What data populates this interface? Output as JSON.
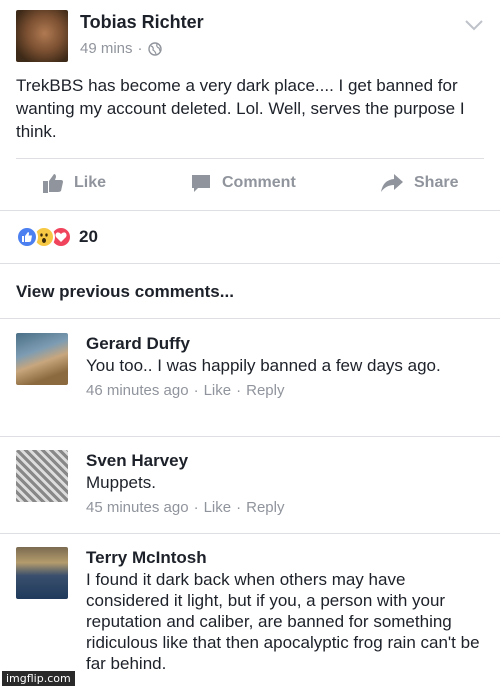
{
  "post": {
    "author": "Tobias Richter",
    "time": "49 mins",
    "meta_separator": "·",
    "text": "TrekBBS has become a very dark place.... I get banned for wanting my account deleted. Lol. Well, serves the purpose I think."
  },
  "actions": {
    "like": "Like",
    "comment": "Comment",
    "share": "Share"
  },
  "reactions": {
    "types": [
      "like",
      "wow",
      "love"
    ],
    "count": "20"
  },
  "view_previous": "View previous comments...",
  "comments": [
    {
      "name": "Gerard Duffy",
      "text": "You too.. I was happily banned a few days ago.",
      "time": "46 minutes ago",
      "like": "Like",
      "reply": "Reply"
    },
    {
      "name": "Sven Harvey",
      "text": "Muppets.",
      "time": "45 minutes ago",
      "like": "Like",
      "reply": "Reply"
    },
    {
      "name": "Terry McIntosh",
      "text": "I found it dark back when others may have considered it light, but if you, a person with your reputation and caliber, are banned for something ridiculous like that then apocalyptic frog rain can't be far behind.",
      "time": "",
      "like": "",
      "reply": ""
    }
  ],
  "watermark": "imgflip.com",
  "colors": {
    "text": "#1d2129",
    "secondary": "#90949c",
    "like_blue": "#4c80f0",
    "wow_yellow": "#f7c843",
    "love_red": "#f0435c",
    "divider": "#dddfe2"
  }
}
